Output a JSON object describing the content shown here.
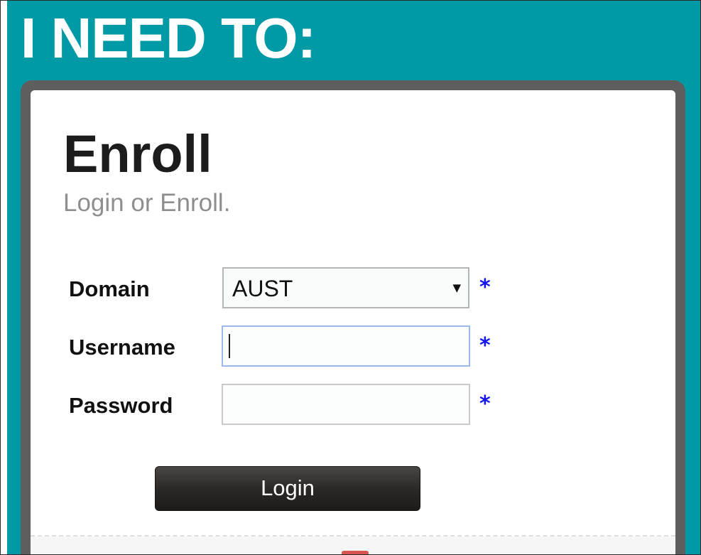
{
  "header": {
    "heading": "I NEED TO:"
  },
  "panel": {
    "title": "Enroll",
    "subtitle": "Login or Enroll."
  },
  "form": {
    "domain": {
      "label": "Domain",
      "selected": "AUST",
      "required_marker": "*"
    },
    "username": {
      "label": "Username",
      "value": "",
      "required_marker": "*"
    },
    "password": {
      "label": "Password",
      "value": "",
      "required_marker": "*"
    },
    "login_label": "Login"
  },
  "icons": {
    "select_arrow": "chevron-down-icon"
  },
  "colors": {
    "header_background": "#009aa6",
    "panel_border": "#5e5e5e",
    "required_marker": "#1414e8",
    "button": "#2b2826"
  }
}
